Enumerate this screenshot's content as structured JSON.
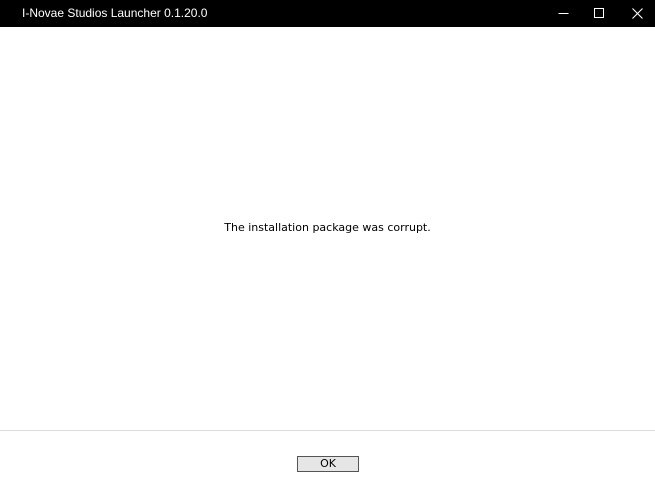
{
  "window": {
    "title": "I-Novae Studios Launcher 0.1.20.0",
    "controls": {
      "minimize_icon": "minimize-icon",
      "maximize_icon": "maximize-icon",
      "close_icon": "close-icon"
    }
  },
  "dialog": {
    "message": "The installation package was corrupt.",
    "ok_label": "OK"
  },
  "colors": {
    "titlebar_bg": "#000000",
    "titlebar_text": "#ffffff",
    "content_bg": "#ffffff",
    "button_bg": "#e6e6e6",
    "button_border": "#555555"
  }
}
